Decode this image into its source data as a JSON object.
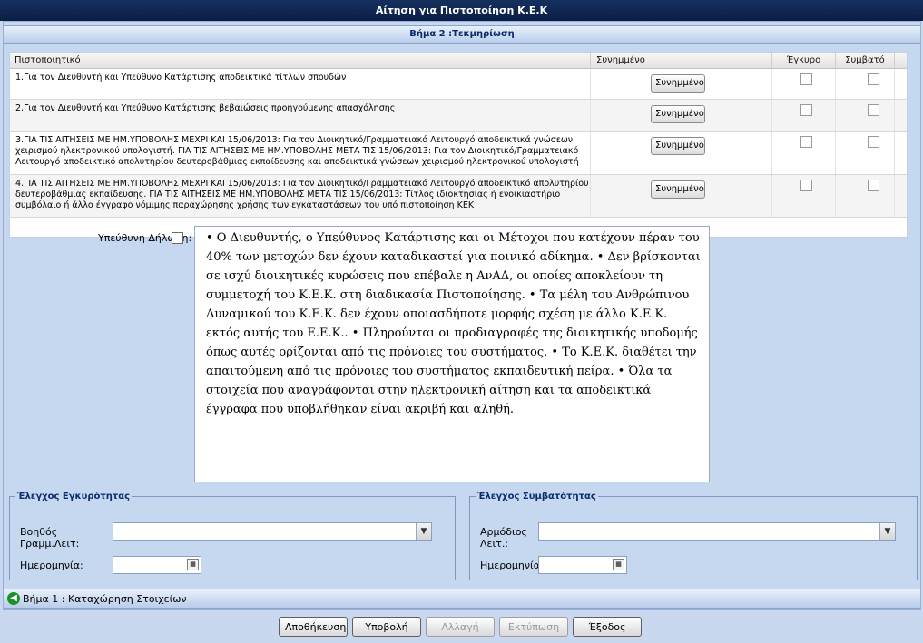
{
  "window": {
    "title": "Αίτηση για Πιστοποίηση Κ.Ε.Κ"
  },
  "step": {
    "title": "Βήμα 2 :Τεκμηρίωση"
  },
  "grid": {
    "columns": [
      "Πιστοποιητικό",
      "Συνημμένο",
      "Έγκυρο",
      "Συμβατό"
    ],
    "rows": [
      {
        "description": "1.Για τον Διευθυντή και Υπεύθυνο Κατάρτισης αποδεικτικά τίτλων σπουδών",
        "attach_label": "Συνημμένο",
        "valid": false,
        "compatible": false
      },
      {
        "description": "2.Για τον Διευθυντή και Υπεύθυνο Κατάρτισης βεβαιώσεις προηγούμενης απασχόλησης",
        "attach_label": "Συνημμένο",
        "valid": false,
        "compatible": false
      },
      {
        "description": "3.ΓΙΑ ΤΙΣ ΑΙΤΗΣΕΙΣ ΜΕ ΗΜ.ΥΠΟΒΟΛΗΣ ΜΕΧΡΙ ΚΑΙ 15/06/2013: Για τον Διοικητικό/Γραμματειακό Λειτουργό αποδεικτικά γνώσεων χειρισμού ηλεκτρονικού υπολογιστή. ΓΙΑ ΤΙΣ ΑΙΤΗΣΕΙΣ ΜΕ ΗΜ.ΥΠΟΒΟΛΗΣ ΜΕΤΑ ΤΙΣ 15/06/2013: Για τον Διοικητικό/Γραμματειακό Λειτουργό αποδεικτικό απολυτηρίου δευτεροβάθμιας εκπαίδευσης και αποδεικτικά γνώσεων χειρισμού ηλεκτρονικού υπολογιστή",
        "attach_label": "Συνημμένο",
        "valid": false,
        "compatible": false
      },
      {
        "description": "4.ΓΙΑ ΤΙΣ ΑΙΤΗΣΕΙΣ ΜΕ ΗΜ.ΥΠΟΒΟΛΗΣ ΜΕΧΡΙ ΚΑΙ 15/06/2013: Για τον Διοικητικό/Γραμματειακό Λειτουργό αποδεικτικό απολυτηρίου δευτεροβάθμιας εκπαίδευσης. ΓΙΑ ΤΙΣ ΑΙΤΗΣΕΙΣ ΜΕ ΗΜ.ΥΠΟΒΟΛΗΣ ΜΕΤΑ ΤΙΣ 15/06/2013: Τίτλος ιδιοκτησίας ή ενοικιαστήριο συμβόλαιο ή άλλο έγγραφο νόμιμης παραχώρησης χρήσης των εγκαταστάσεων του υπό πιστοποίηση ΚΕΚ",
        "attach_label": "Συνημμένο",
        "valid": false,
        "compatible": false
      }
    ]
  },
  "declaration": {
    "label": "Υπεύθυνη Δήλωση:",
    "checked": false,
    "text": "• Ο Διευθυντής, ο Υπεύθυνος Κατάρτισης και οι Μέτοχοι που κατέχουν πέραν του 40% των μετοχών δεν έχουν καταδικαστεί για ποινικό αδίκημα. • Δεν βρίσκονται σε ισχύ διοικητικές κυρώσεις που επέβαλε η ΑνΑΔ, οι οποίες αποκλείουν τη συμμετοχή του Κ.Ε.Κ. στη διαδικασία Πιστοποίησης. • Τα μέλη του Ανθρώπινου Δυναμικού του Κ.Ε.Κ. δεν έχουν οποιασδήποτε μορφής σχέση με άλλο Κ.Ε.Κ. εκτός αυτής του Ε.Ε.Κ.. • Πληρούνται οι προδιαγραφές της διοικητικής υποδομής όπως αυτές ορίζονται από τις πρόνοιες του συστήματος. • Το Κ.Ε.Κ. διαθέτει την απαιτούμενη από τις πρόνοιες του συστήματος εκπαιδευτική πείρα. • Όλα τα στοιχεία που αναγράφονται στην ηλεκτρονική αίτηση και τα αποδεικτικά έγγραφα που υποβλήθηκαν είναι ακριβή και αληθή."
  },
  "validity_check": {
    "legend": "Έλεγχος Εγκυρότητας",
    "officer_label": "Βοηθός Γραμμ.Λειτ:",
    "officer_value": "",
    "date_label": "Ημερομηνία:",
    "date_value": ""
  },
  "compatibility_check": {
    "legend": "Έλεγχος Συμβατότητας",
    "officer_label": "Αρμόδιος Λειτ.:",
    "officer_value": "",
    "date_label": "Ημερομηνία:",
    "date_value": ""
  },
  "navigation": {
    "back_label": "Βήμα 1 : Καταχώρηση Στοιχείων"
  },
  "actions": {
    "save": "Αποθήκευση",
    "submit": "Υποβολή",
    "change": "Αλλαγή",
    "print": "Εκτύπωση",
    "exit": "Έξοδος"
  },
  "colors": {
    "title_bar": "#0b1d45",
    "background": "#c9d8ef",
    "legend_text": "#0b2c6e",
    "back_icon": "#1f8f2e"
  }
}
